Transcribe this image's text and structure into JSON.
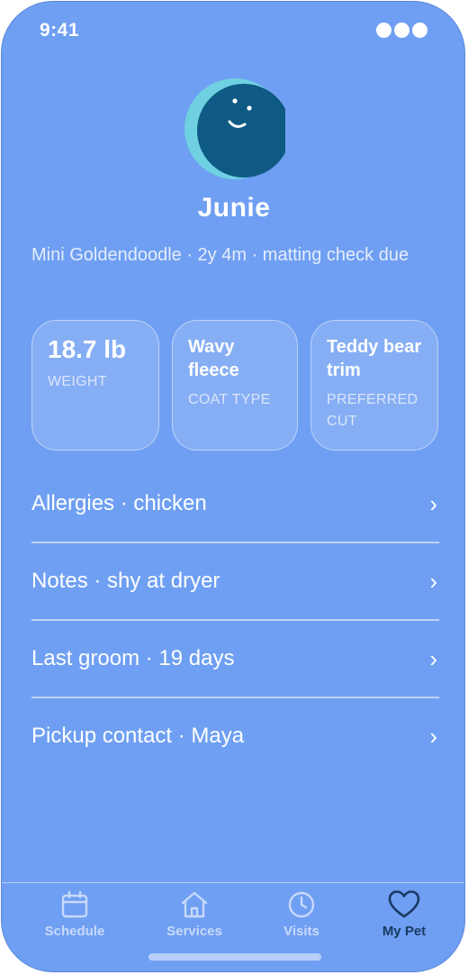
{
  "status_bar": {
    "time": "9:41"
  },
  "profile": {
    "name": "Junie",
    "subtitle": "Mini Goldendoodle · 2y 4m · matting check due"
  },
  "stats": [
    {
      "value": "18.7 lb",
      "label": "WEIGHT"
    },
    {
      "value": "Wavy fleece",
      "label": "COAT TYPE"
    },
    {
      "value": "Teddy bear trim",
      "label": "PREFERRED CUT"
    }
  ],
  "details": [
    {
      "label": "Allergies · chicken"
    },
    {
      "label": "Notes · shy at dryer"
    },
    {
      "label": "Last groom · 19 days"
    },
    {
      "label": "Pickup contact · Maya"
    }
  ],
  "chevron": "›",
  "tabs": [
    {
      "label": "Schedule",
      "icon": "calendar-icon",
      "active": false
    },
    {
      "label": "Services",
      "icon": "home-icon",
      "active": false
    },
    {
      "label": "Visits",
      "icon": "clock-icon",
      "active": false
    },
    {
      "label": "My Pet",
      "icon": "heart-icon",
      "active": true
    }
  ],
  "colors": {
    "background": "#6f9ff2",
    "avatar_dark": "#0e5a84",
    "avatar_accent": "#6fd0e2",
    "active_tab": "#173a63",
    "inactive_tab": "#c8d9fb"
  }
}
